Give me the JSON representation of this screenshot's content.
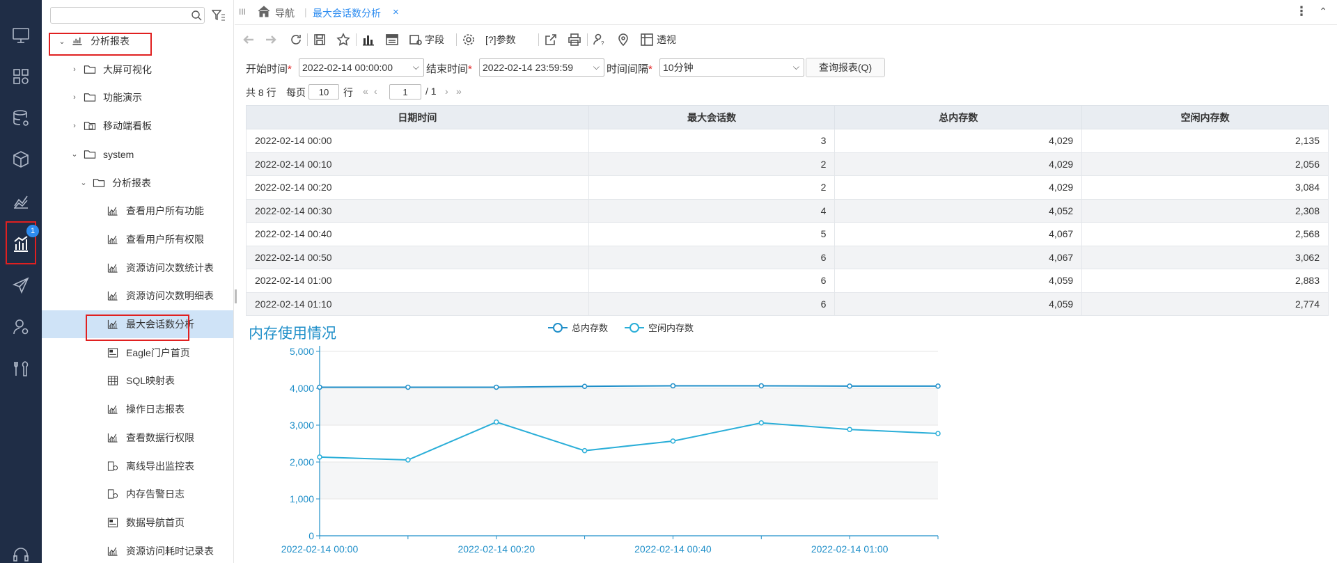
{
  "leftbar": {
    "icons": [
      "monitor-icon",
      "dashboard-icon",
      "database-gear-icon",
      "cube-icon",
      "chart-area-icon",
      "analysis-report-icon",
      "send-icon",
      "user-settings-icon",
      "tools-icon",
      "headset-icon"
    ],
    "badge": "1"
  },
  "tree": {
    "search_placeholder": "",
    "items": [
      {
        "label": "分析报表",
        "level": 0,
        "chevron": "⌄",
        "icon": "report-icon"
      },
      {
        "label": "大屏可视化",
        "level": 1,
        "chevron": "›",
        "icon": "folder-icon"
      },
      {
        "label": "功能演示",
        "level": 1,
        "chevron": "›",
        "icon": "folder-icon"
      },
      {
        "label": "移动端看板",
        "level": 1,
        "chevron": "›",
        "icon": "folder-mobile-icon"
      },
      {
        "label": "system",
        "level": 1,
        "chevron": "⌄",
        "icon": "folder-icon"
      },
      {
        "label": "分析报表",
        "level": 2,
        "chevron": "⌄",
        "icon": "folder-icon"
      },
      {
        "label": "查看用户所有功能",
        "level": 3,
        "chevron": "",
        "icon": "chart-report-icon"
      },
      {
        "label": "查看用户所有权限",
        "level": 3,
        "chevron": "",
        "icon": "chart-report-icon"
      },
      {
        "label": "资源访问次数统计表",
        "level": 3,
        "chevron": "",
        "icon": "chart-report-icon"
      },
      {
        "label": "资源访问次数明细表",
        "level": 3,
        "chevron": "",
        "icon": "chart-report-icon"
      },
      {
        "label": "最大会话数分析",
        "level": 3,
        "chevron": "",
        "icon": "chart-report-icon"
      },
      {
        "label": "Eagle门户首页",
        "level": 3,
        "chevron": "",
        "icon": "portal-icon"
      },
      {
        "label": "SQL映射表",
        "level": 3,
        "chevron": "",
        "icon": "table-grid-icon"
      },
      {
        "label": "操作日志报表",
        "level": 3,
        "chevron": "",
        "icon": "chart-report-icon"
      },
      {
        "label": "查看数据行权限",
        "level": 3,
        "chevron": "",
        "icon": "chart-report-icon"
      },
      {
        "label": "离线导出监控表",
        "level": 3,
        "chevron": "",
        "icon": "export-monitor-icon"
      },
      {
        "label": "内存告警日志",
        "level": 3,
        "chevron": "",
        "icon": "export-monitor-icon"
      },
      {
        "label": "数据导航首页",
        "level": 3,
        "chevron": "",
        "icon": "portal-icon"
      },
      {
        "label": "资源访问耗时记录表",
        "level": 3,
        "chevron": "",
        "icon": "chart-report-icon"
      }
    ]
  },
  "tabs": {
    "nav_label": "导航",
    "active_label": "最大会话数分析",
    "close": "×",
    "more": "⋮",
    "menu": "III"
  },
  "toolbar": {
    "field_label": "字段",
    "param_label": "[?]参数",
    "pivot_label": "透视"
  },
  "params": {
    "start_label": "开始时间",
    "start_value": "2022-02-14 00:00:00",
    "end_label": "结束时间",
    "end_value": "2022-02-14 23:59:59",
    "interval_label": "时间间隔",
    "interval_value": "10分钟",
    "required_mark": "*",
    "query_button": "查询报表(Q)"
  },
  "pager": {
    "total": "共 8 行",
    "per_page_label": "每页",
    "per_page_value": "10",
    "row_unit": "行",
    "page_value": "1",
    "page_total": "/ 1"
  },
  "table": {
    "headers": [
      "日期时间",
      "最大会话数",
      "总内存数",
      "空闲内存数"
    ],
    "rows": [
      [
        "2022-02-14  00:00",
        "3",
        "4,029",
        "2,135"
      ],
      [
        "2022-02-14  00:10",
        "2",
        "4,029",
        "2,056"
      ],
      [
        "2022-02-14  00:20",
        "2",
        "4,029",
        "3,084"
      ],
      [
        "2022-02-14  00:30",
        "4",
        "4,052",
        "2,308"
      ],
      [
        "2022-02-14  00:40",
        "5",
        "4,067",
        "2,568"
      ],
      [
        "2022-02-14  00:50",
        "6",
        "4,067",
        "3,062"
      ],
      [
        "2022-02-14  01:00",
        "6",
        "4,059",
        "2,883"
      ],
      [
        "2022-02-14  01:10",
        "6",
        "4,059",
        "2,774"
      ]
    ]
  },
  "chart_data": {
    "type": "line",
    "title": "内存使用情况",
    "x": [
      "2022-02-14 00:00",
      "2022-02-14 00:10",
      "2022-02-14 00:20",
      "2022-02-14 00:30",
      "2022-02-14 00:40",
      "2022-02-14 00:50",
      "2022-02-14 01:00",
      "2022-02-14 01:10"
    ],
    "x_tick_labels": [
      "2022-02-14 00:00",
      "2022-02-14 00:20",
      "2022-02-14 00:40",
      "2022-02-14 01:00"
    ],
    "y_ticks": [
      "0",
      "1,000",
      "2,000",
      "3,000",
      "4,000",
      "5,000"
    ],
    "ylim": [
      0,
      5000
    ],
    "series": [
      {
        "name": "总内存数",
        "values": [
          4029,
          4029,
          4029,
          4052,
          4067,
          4067,
          4059,
          4059
        ],
        "color": "#1f8fc9"
      },
      {
        "name": "空闲内存数",
        "values": [
          2135,
          2056,
          3084,
          2308,
          2568,
          3062,
          2883,
          2774
        ],
        "color": "#2aaed8"
      }
    ],
    "legend": "top-center",
    "grid": true
  }
}
